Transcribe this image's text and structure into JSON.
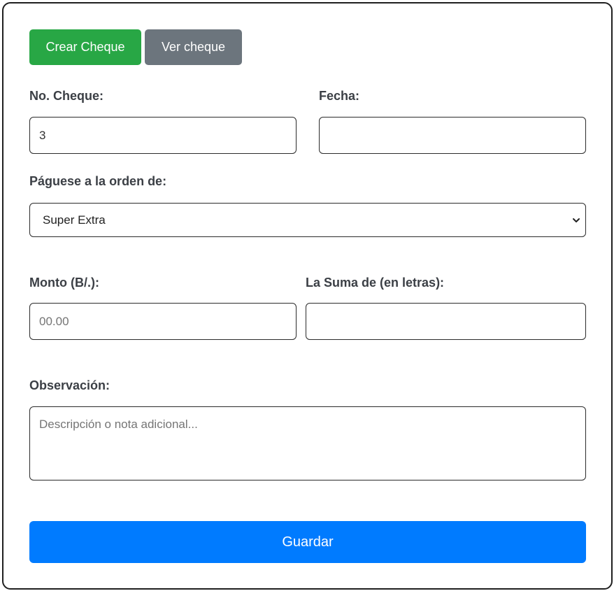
{
  "tabs": {
    "crear_label": "Crear Cheque",
    "ver_label": "Ver cheque"
  },
  "form": {
    "no_cheque": {
      "label": "No. Cheque:",
      "value": "3"
    },
    "fecha": {
      "label": "Fecha:",
      "value": ""
    },
    "paguese": {
      "label": "Páguese a la orden de:",
      "selected": "Super Extra"
    },
    "monto": {
      "label": "Monto (B/.):",
      "placeholder": "00.00",
      "value": ""
    },
    "suma": {
      "label": "La Suma de (en letras):",
      "value": ""
    },
    "observacion": {
      "label": "Observación:",
      "placeholder": "Descripción o nota adicional..."
    }
  },
  "actions": {
    "save_label": "Guardar"
  },
  "colors": {
    "crear_tab": "#28a745",
    "ver_tab": "#6c757d",
    "save_button": "#007bff",
    "label_text": "#3b3f45"
  },
  "icons": {
    "select_chevron": "chevron-down-icon"
  }
}
